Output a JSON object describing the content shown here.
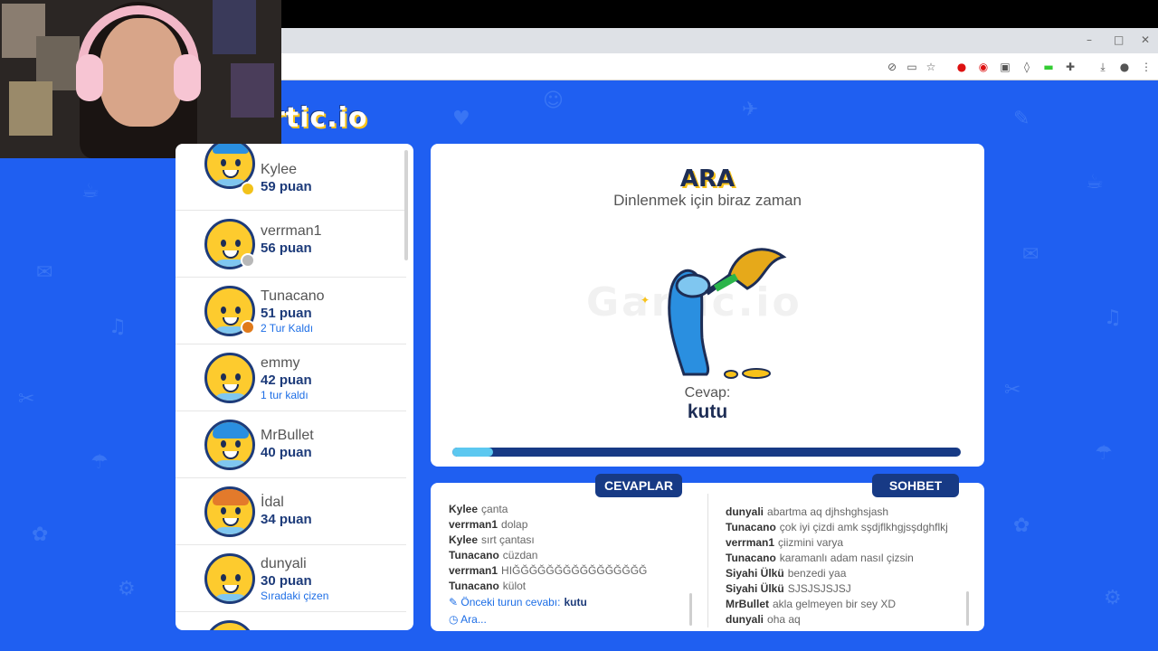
{
  "browser": {
    "window_controls": [
      "–",
      "□",
      "✕"
    ],
    "toolbar_icons": [
      "camera-off-icon",
      "screen-cast-icon",
      "star-icon",
      "opera-icon",
      "adblock-icon",
      "extension-square-icon",
      "shield-icon",
      "battery-icon",
      "puzzle-icon",
      "download-icon",
      "profile-icon",
      "more-icon"
    ]
  },
  "logo": {
    "text": "rtic.io"
  },
  "players": [
    {
      "name": "Kylee",
      "score": "59 puan",
      "note": "",
      "status_color": "#f2c21a",
      "hair": "#2a8fe0"
    },
    {
      "name": "verrman1",
      "score": "56 puan",
      "note": "",
      "status_color": "#b8b8b8",
      "hair": ""
    },
    {
      "name": "Tunacano",
      "score": "51 puan",
      "note": "2 Tur Kaldı",
      "status_color": "#e07a1a",
      "hair": ""
    },
    {
      "name": "emmy",
      "score": "42 puan",
      "note": "1 tur kaldı",
      "status_color": "",
      "hair": ""
    },
    {
      "name": "MrBullet",
      "score": "40 puan",
      "note": "",
      "status_color": "",
      "hair": "#2a8fe0"
    },
    {
      "name": "İdal",
      "score": "34 puan",
      "note": "",
      "status_color": "",
      "hair": "#e37a2b"
    },
    {
      "name": "dunyali",
      "score": "30 puan",
      "note": "Sıradaki çizen",
      "status_color": "",
      "hair": ""
    }
  ],
  "main": {
    "title": "ARA",
    "subtitle": "Dinlenmek için biraz zaman",
    "watermark": "Gartic.io",
    "answer_label": "Cevap:",
    "answer_word": "kutu",
    "progress": 0.08
  },
  "tabs": {
    "answers": "CEVAPLAR",
    "chat": "SOHBET"
  },
  "answers": [
    {
      "user": "Kylee",
      "text": "çanta"
    },
    {
      "user": "verrman1",
      "text": "dolap"
    },
    {
      "user": "Kylee",
      "text": "sırt çantası"
    },
    {
      "user": "Tunacano",
      "text": "cüzdan"
    },
    {
      "user": "verrman1",
      "text": "HIĞĞĞĞĞĞĞĞĞĞĞĞĞĞĞĞ"
    },
    {
      "user": "Tunacano",
      "text": "külot"
    }
  ],
  "answer_info": {
    "prev_label": "Önceki turun cevabı:",
    "prev_word": "kutu",
    "waiting": "Ara..."
  },
  "chat": [
    {
      "user": "dunyali",
      "text": "abartma aq djhshghsjash"
    },
    {
      "user": "Tunacano",
      "text": "çok iyi çizdi amk sşdjflkhgjsşdghflkj"
    },
    {
      "user": "verrman1",
      "text": "çiizmini varya"
    },
    {
      "user": "Tunacano",
      "text": "karamanlı adam nasıl çizsin"
    },
    {
      "user": "Siyahi Ülkü",
      "text": "benzedi yaa"
    },
    {
      "user": "Siyahi Ülkü",
      "text": "SJSJSJSJSJ"
    },
    {
      "user": "MrBullet",
      "text": "akla gelmeyen bir sey XD"
    },
    {
      "user": "dunyali",
      "text": "oha aq"
    }
  ],
  "colors": {
    "background": "#1f5ff1",
    "navy": "#173a85",
    "accent_yellow": "#f8c21a",
    "link_blue": "#1d6ee6"
  }
}
